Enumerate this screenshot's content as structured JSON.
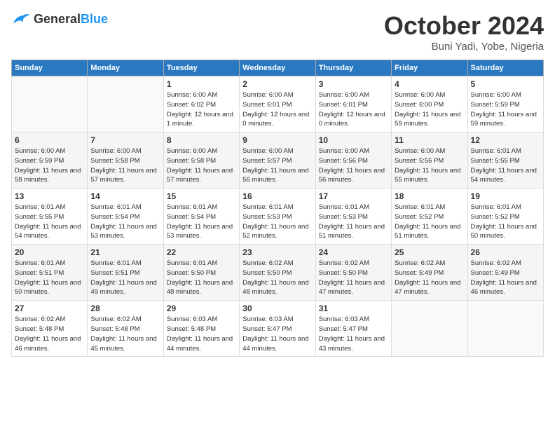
{
  "header": {
    "logo_general": "General",
    "logo_blue": "Blue",
    "month": "October 2024",
    "location": "Buni Yadi, Yobe, Nigeria"
  },
  "weekdays": [
    "Sunday",
    "Monday",
    "Tuesday",
    "Wednesday",
    "Thursday",
    "Friday",
    "Saturday"
  ],
  "weeks": [
    [
      {
        "day": "",
        "info": ""
      },
      {
        "day": "",
        "info": ""
      },
      {
        "day": "1",
        "sunrise": "6:00 AM",
        "sunset": "6:02 PM",
        "daylight": "12 hours and 1 minute."
      },
      {
        "day": "2",
        "sunrise": "6:00 AM",
        "sunset": "6:01 PM",
        "daylight": "12 hours and 0 minutes."
      },
      {
        "day": "3",
        "sunrise": "6:00 AM",
        "sunset": "6:01 PM",
        "daylight": "12 hours and 0 minutes."
      },
      {
        "day": "4",
        "sunrise": "6:00 AM",
        "sunset": "6:00 PM",
        "daylight": "11 hours and 59 minutes."
      },
      {
        "day": "5",
        "sunrise": "6:00 AM",
        "sunset": "5:59 PM",
        "daylight": "11 hours and 59 minutes."
      }
    ],
    [
      {
        "day": "6",
        "sunrise": "6:00 AM",
        "sunset": "5:59 PM",
        "daylight": "11 hours and 58 minutes."
      },
      {
        "day": "7",
        "sunrise": "6:00 AM",
        "sunset": "5:58 PM",
        "daylight": "11 hours and 57 minutes."
      },
      {
        "day": "8",
        "sunrise": "6:00 AM",
        "sunset": "5:58 PM",
        "daylight": "11 hours and 57 minutes."
      },
      {
        "day": "9",
        "sunrise": "6:00 AM",
        "sunset": "5:57 PM",
        "daylight": "11 hours and 56 minutes."
      },
      {
        "day": "10",
        "sunrise": "6:00 AM",
        "sunset": "5:56 PM",
        "daylight": "11 hours and 56 minutes."
      },
      {
        "day": "11",
        "sunrise": "6:00 AM",
        "sunset": "5:56 PM",
        "daylight": "11 hours and 55 minutes."
      },
      {
        "day": "12",
        "sunrise": "6:01 AM",
        "sunset": "5:55 PM",
        "daylight": "11 hours and 54 minutes."
      }
    ],
    [
      {
        "day": "13",
        "sunrise": "6:01 AM",
        "sunset": "5:55 PM",
        "daylight": "11 hours and 54 minutes."
      },
      {
        "day": "14",
        "sunrise": "6:01 AM",
        "sunset": "5:54 PM",
        "daylight": "11 hours and 53 minutes."
      },
      {
        "day": "15",
        "sunrise": "6:01 AM",
        "sunset": "5:54 PM",
        "daylight": "11 hours and 53 minutes."
      },
      {
        "day": "16",
        "sunrise": "6:01 AM",
        "sunset": "5:53 PM",
        "daylight": "11 hours and 52 minutes."
      },
      {
        "day": "17",
        "sunrise": "6:01 AM",
        "sunset": "5:53 PM",
        "daylight": "11 hours and 51 minutes."
      },
      {
        "day": "18",
        "sunrise": "6:01 AM",
        "sunset": "5:52 PM",
        "daylight": "11 hours and 51 minutes."
      },
      {
        "day": "19",
        "sunrise": "6:01 AM",
        "sunset": "5:52 PM",
        "daylight": "11 hours and 50 minutes."
      }
    ],
    [
      {
        "day": "20",
        "sunrise": "6:01 AM",
        "sunset": "5:51 PM",
        "daylight": "11 hours and 50 minutes."
      },
      {
        "day": "21",
        "sunrise": "6:01 AM",
        "sunset": "5:51 PM",
        "daylight": "11 hours and 49 minutes."
      },
      {
        "day": "22",
        "sunrise": "6:01 AM",
        "sunset": "5:50 PM",
        "daylight": "11 hours and 48 minutes."
      },
      {
        "day": "23",
        "sunrise": "6:02 AM",
        "sunset": "5:50 PM",
        "daylight": "11 hours and 48 minutes."
      },
      {
        "day": "24",
        "sunrise": "6:02 AM",
        "sunset": "5:50 PM",
        "daylight": "11 hours and 47 minutes."
      },
      {
        "day": "25",
        "sunrise": "6:02 AM",
        "sunset": "5:49 PM",
        "daylight": "11 hours and 47 minutes."
      },
      {
        "day": "26",
        "sunrise": "6:02 AM",
        "sunset": "5:49 PM",
        "daylight": "11 hours and 46 minutes."
      }
    ],
    [
      {
        "day": "27",
        "sunrise": "6:02 AM",
        "sunset": "5:48 PM",
        "daylight": "11 hours and 46 minutes."
      },
      {
        "day": "28",
        "sunrise": "6:02 AM",
        "sunset": "5:48 PM",
        "daylight": "11 hours and 45 minutes."
      },
      {
        "day": "29",
        "sunrise": "6:03 AM",
        "sunset": "5:48 PM",
        "daylight": "11 hours and 44 minutes."
      },
      {
        "day": "30",
        "sunrise": "6:03 AM",
        "sunset": "5:47 PM",
        "daylight": "11 hours and 44 minutes."
      },
      {
        "day": "31",
        "sunrise": "6:03 AM",
        "sunset": "5:47 PM",
        "daylight": "11 hours and 43 minutes."
      },
      {
        "day": "",
        "info": ""
      },
      {
        "day": "",
        "info": ""
      }
    ]
  ]
}
